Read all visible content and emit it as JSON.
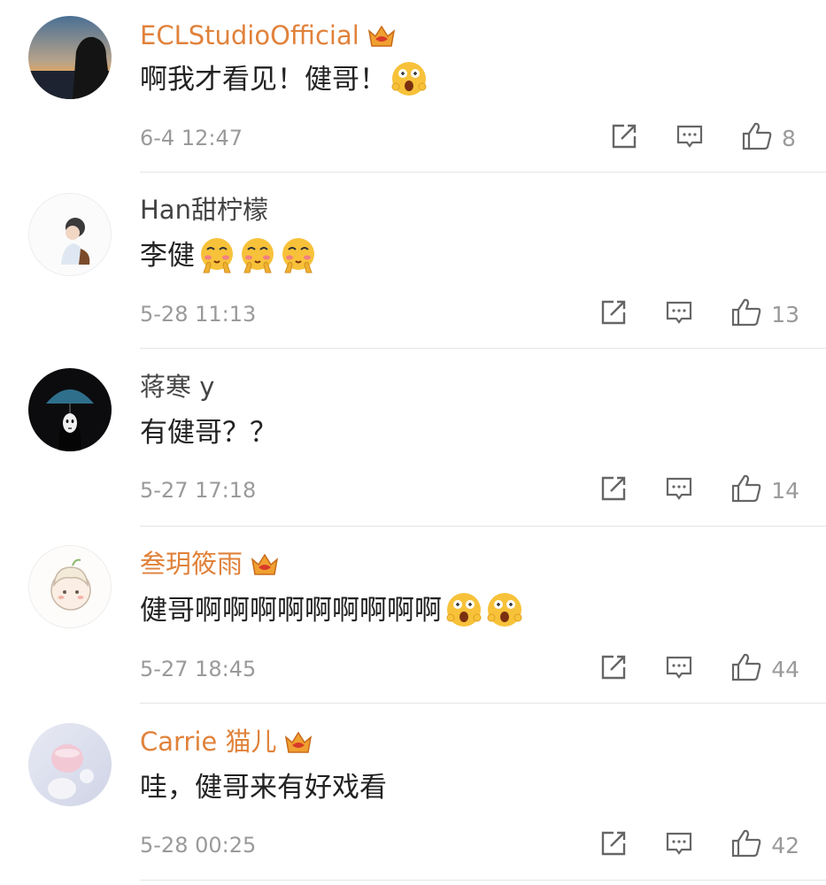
{
  "comments": [
    {
      "username": "ECLStudioOfficial",
      "vip": true,
      "text": "啊我才看见！健哥！",
      "emoji": "surprised-emoji",
      "emoji_count": 1,
      "time": "6-4 12:47",
      "likes": "8"
    },
    {
      "username": "Han甜柠檬",
      "vip": false,
      "text": "李健",
      "emoji": "shy-emoji",
      "emoji_count": 3,
      "time": "5-28 11:13",
      "likes": "13"
    },
    {
      "username": "蒋寒 y",
      "vip": false,
      "text": "有健哥？？",
      "emoji": "",
      "emoji_count": 0,
      "time": "5-27 17:18",
      "likes": "14"
    },
    {
      "username": "叁玥筱雨",
      "vip": true,
      "text": "健哥啊啊啊啊啊啊啊啊啊",
      "emoji": "surprised-emoji",
      "emoji_count": 2,
      "time": "5-27 18:45",
      "likes": "44"
    },
    {
      "username": "Carrie 猫儿",
      "vip": true,
      "text": "哇，健哥来有好戏看",
      "emoji": "",
      "emoji_count": 0,
      "time": "5-28 00:25",
      "likes": "42"
    }
  ],
  "colors": {
    "vip_name": "#e0823b",
    "normal_name": "#444444",
    "meta": "#9a9a9a",
    "divider": "#e5e5e5"
  }
}
